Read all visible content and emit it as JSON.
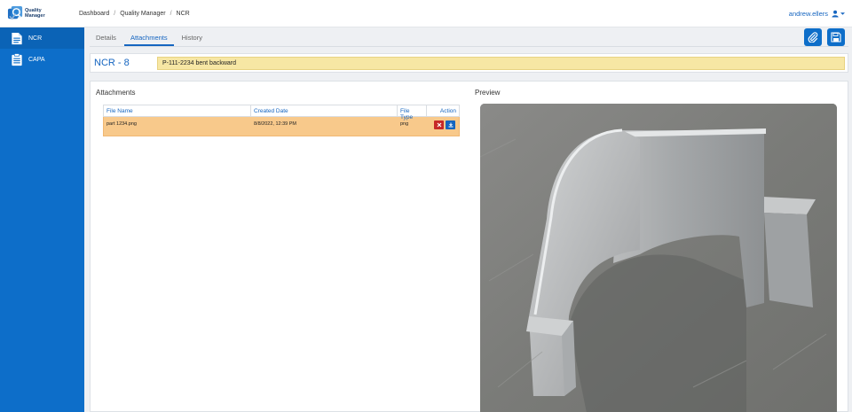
{
  "app": {
    "logo_line1": "Quality",
    "logo_line2": "Manager"
  },
  "breadcrumb": [
    "Dashboard",
    "Quality Manager",
    "NCR"
  ],
  "user": {
    "name": "andrew.ellers"
  },
  "sidebar": {
    "items": [
      {
        "label": "NCR",
        "icon": "document-icon"
      },
      {
        "label": "CAPA",
        "icon": "clipboard-icon"
      }
    ]
  },
  "tabs": [
    {
      "label": "Details",
      "active": false
    },
    {
      "label": "Attachments",
      "active": true
    },
    {
      "label": "History",
      "active": false
    }
  ],
  "toolbar": {
    "attach_icon": "paperclip-icon",
    "save_icon": "save-icon"
  },
  "record": {
    "title": "NCR - 8",
    "description": "P-111-2234 bent backward"
  },
  "attachments": {
    "title": "Attachments",
    "columns": [
      "File Name",
      "Created Date",
      "File Type",
      "Action"
    ],
    "rows": [
      {
        "file_name": "part 1234.png",
        "created_date": "8/8/2022, 12:39 PM",
        "file_type": "png"
      }
    ]
  },
  "preview": {
    "title": "Preview"
  },
  "colors": {
    "accent": "#0d6ec9",
    "selected_row": "#f8c98b",
    "description_bg": "#f7e7a4",
    "delete": "#c62828"
  }
}
